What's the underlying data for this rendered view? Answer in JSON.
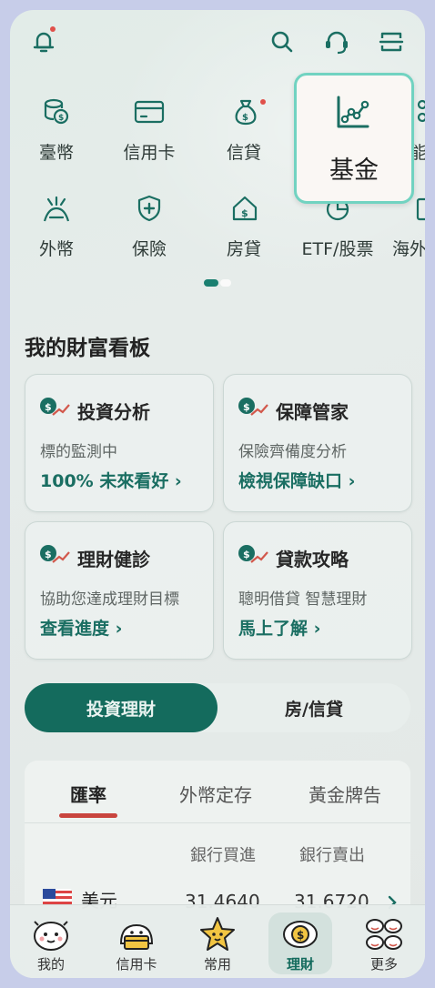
{
  "menu_row1": [
    {
      "label": "臺幣",
      "icon": "coins-icon"
    },
    {
      "label": "信用卡",
      "icon": "credit-card-icon"
    },
    {
      "label": "信貸",
      "icon": "money-bag-icon"
    },
    {
      "label": "基金",
      "icon": "fund-chart-icon"
    },
    {
      "label": "智能",
      "icon": "robo-icon"
    }
  ],
  "menu_row2": [
    {
      "label": "外幣",
      "icon": "foreign-currency-icon"
    },
    {
      "label": "保險",
      "icon": "shield-icon"
    },
    {
      "label": "房貸",
      "icon": "house-icon"
    },
    {
      "label": "ETF/股票",
      "icon": "pie-chart-icon"
    },
    {
      "label": "海外",
      "icon": "overseas-icon"
    }
  ],
  "section_title": "我的財富看板",
  "cards": [
    {
      "title": "投資分析",
      "sub": "標的監測中",
      "link": "100% 未來看好 ›"
    },
    {
      "title": "保障管家",
      "sub": "保險齊備度分析",
      "link": "檢視保障缺口 ›"
    },
    {
      "title": "理財健診",
      "sub": "協助您達成理財目標",
      "link": "查看進度 ›"
    },
    {
      "title": "貸款攻略",
      "sub": "聰明借貸 智慧理財",
      "link": "馬上了解 ›"
    }
  ],
  "toggle": {
    "on": "投資理財",
    "off": "房/信貸"
  },
  "rate_tabs": [
    "匯率",
    "外幣定存",
    "黃金牌告"
  ],
  "rate_headers": {
    "buy": "銀行買進",
    "sell": "銀行賣出"
  },
  "rate_row": {
    "currency": "美元",
    "buy": "31.4640",
    "sell": "31.6720"
  },
  "bottom_nav": [
    {
      "label": "我的"
    },
    {
      "label": "信用卡"
    },
    {
      "label": "常用"
    },
    {
      "label": "理財"
    },
    {
      "label": "更多"
    }
  ],
  "colors": {
    "accent": "#1a6e62",
    "toggle_active": "#146b5d",
    "tab_underline": "#c9453e",
    "highlight_border": "#71d3c1"
  }
}
